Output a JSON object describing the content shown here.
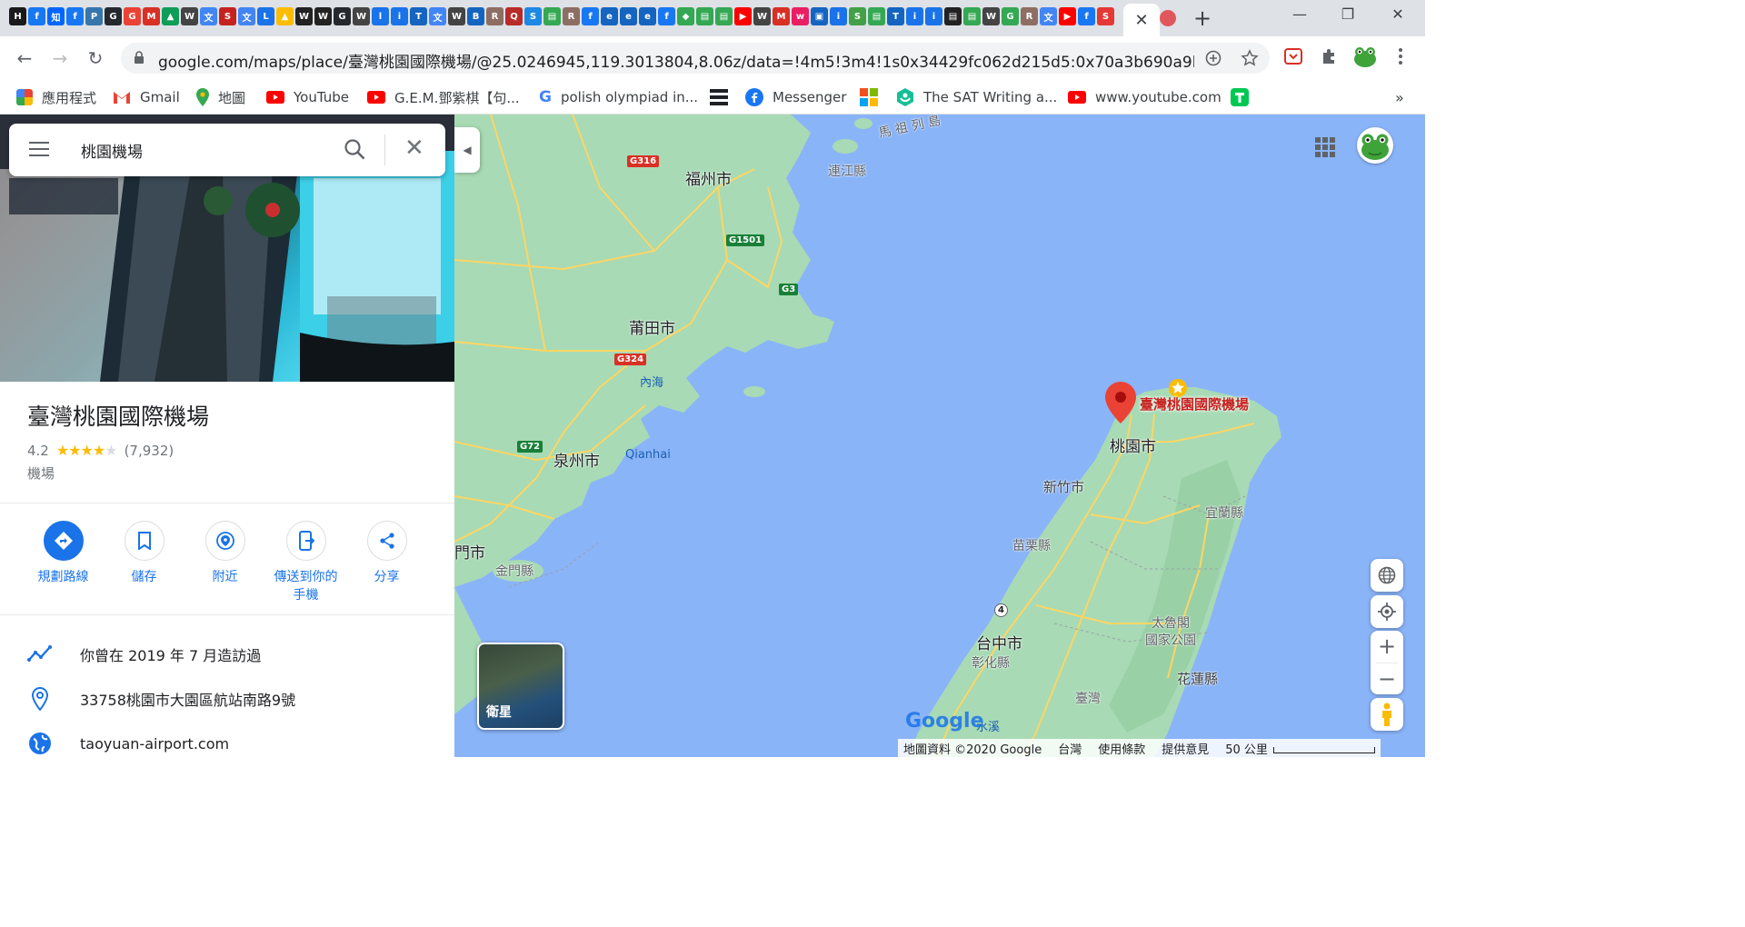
{
  "browser": {
    "favicons": [
      {
        "glyph": "H",
        "color": "#1a1a1a"
      },
      {
        "glyph": "f",
        "color": "#1877f2"
      },
      {
        "glyph": "知",
        "color": "#0066ff"
      },
      {
        "glyph": "f",
        "color": "#1877f2"
      },
      {
        "glyph": "P",
        "color": "#3776ab"
      },
      {
        "glyph": "G",
        "color": "#24292e"
      },
      {
        "glyph": "G",
        "color": "#ea4335"
      },
      {
        "glyph": "M",
        "color": "#d93025"
      },
      {
        "glyph": "▲",
        "color": "#0f9d58"
      },
      {
        "glyph": "W",
        "color": "#444444"
      },
      {
        "glyph": "文",
        "color": "#4285f4"
      },
      {
        "glyph": "S",
        "color": "#c5221f"
      },
      {
        "glyph": "文",
        "color": "#4285f4"
      },
      {
        "glyph": "L",
        "color": "#1a73e8"
      },
      {
        "glyph": "▲",
        "color": "#fbbc04"
      },
      {
        "glyph": "W",
        "color": "#222222"
      },
      {
        "glyph": "W",
        "color": "#222222"
      },
      {
        "glyph": "G",
        "color": "#24292e"
      },
      {
        "glyph": "W",
        "color": "#444444"
      },
      {
        "glyph": "l",
        "color": "#1a73e8"
      },
      {
        "glyph": "i",
        "color": "#1a73e8"
      },
      {
        "glyph": "T",
        "color": "#1565c0"
      },
      {
        "glyph": "文",
        "color": "#4285f4"
      },
      {
        "glyph": "W",
        "color": "#444444"
      },
      {
        "glyph": "B",
        "color": "#1565c0"
      },
      {
        "glyph": "R",
        "color": "#8d6e63"
      },
      {
        "glyph": "Q",
        "color": "#b92b27"
      },
      {
        "glyph": "S",
        "color": "#1e88e5"
      },
      {
        "glyph": "▤",
        "color": "#34a853"
      },
      {
        "glyph": "R",
        "color": "#8d6e63"
      },
      {
        "glyph": "f",
        "color": "#1877f2"
      },
      {
        "glyph": "e",
        "color": "#1565c0"
      },
      {
        "glyph": "e",
        "color": "#1565c0"
      },
      {
        "glyph": "e",
        "color": "#1565c0"
      },
      {
        "glyph": "f",
        "color": "#1877f2"
      },
      {
        "glyph": "◆",
        "color": "#34a853"
      },
      {
        "glyph": "▤",
        "color": "#34a853"
      },
      {
        "glyph": "▤",
        "color": "#34a853"
      },
      {
        "glyph": "▶",
        "color": "#ff0000"
      },
      {
        "glyph": "W",
        "color": "#444444"
      },
      {
        "glyph": "M",
        "color": "#d93025"
      },
      {
        "glyph": "w",
        "color": "#e91e63"
      },
      {
        "glyph": "▣",
        "color": "#1565c0"
      },
      {
        "glyph": "i",
        "color": "#1a73e8"
      },
      {
        "glyph": "S",
        "color": "#43a047"
      },
      {
        "glyph": "▤",
        "color": "#34a853"
      },
      {
        "glyph": "T",
        "color": "#1565c0"
      },
      {
        "glyph": "i",
        "color": "#1a73e8"
      },
      {
        "glyph": "i",
        "color": "#1a73e8"
      },
      {
        "glyph": "▤",
        "color": "#222222"
      },
      {
        "glyph": "▤",
        "color": "#34a853"
      },
      {
        "glyph": "W",
        "color": "#444444"
      },
      {
        "glyph": "G",
        "color": "#34a853"
      },
      {
        "glyph": "R",
        "color": "#8d6e63"
      },
      {
        "glyph": "文",
        "color": "#4285f4"
      },
      {
        "glyph": "▶",
        "color": "#ff0000"
      },
      {
        "glyph": "f",
        "color": "#1877f2"
      },
      {
        "glyph": "S",
        "color": "#e53935"
      }
    ],
    "window_controls": {
      "minimize": "—",
      "restore": "❐",
      "close": "✕"
    },
    "new_tab": "+",
    "tab_close": "✕",
    "url": "google.com/maps/place/臺灣桃園國際機場/@25.0246945,119.3013804,8.06z/data=!4m5!3m4!1s0x34429fc062d215d5:0x70a3b690a9b5b10...",
    "back": "←",
    "forward": "→",
    "reload": "↻"
  },
  "bookmarks": [
    {
      "label": "應用程式",
      "icon": "apps-grid-icon",
      "color": "#ea4335"
    },
    {
      "label": "Gmail",
      "icon": "gmail-icon",
      "color": "#ea4335"
    },
    {
      "label": "地圖",
      "icon": "maps-pin-icon",
      "color": "#34a853"
    },
    {
      "label": "YouTube",
      "icon": "youtube-icon",
      "color": "#ff0000"
    },
    {
      "label": "G.E.M.鄧紫棋【句...",
      "icon": "youtube-icon",
      "color": "#ff0000"
    },
    {
      "label": "polish olympiad in...",
      "icon": "google-icon",
      "color": "#4285f4"
    },
    {
      "label": "",
      "icon": "list-icon",
      "color": "#202124"
    },
    {
      "label": "Messenger",
      "icon": "facebook-icon",
      "color": "#1877f2"
    },
    {
      "label": "",
      "icon": "microsoft-icon",
      "color": "#f25022"
    },
    {
      "label": "The SAT Writing a...",
      "icon": "khan-icon",
      "color": "#14bf96"
    },
    {
      "label": "www.youtube.com",
      "icon": "youtube-icon",
      "color": "#ff0000"
    },
    {
      "label": "",
      "icon": "green-t-icon",
      "color": "#00c853"
    }
  ],
  "bookmarks_more": "»",
  "search": {
    "query": "桃園機場"
  },
  "place": {
    "title": "臺灣桃園國際機場",
    "rating": "4.2",
    "rating_value": 4.2,
    "stars": "★★★★",
    "stars_off": "★",
    "reviews": "(7,932)",
    "category": "機場"
  },
  "actions": [
    {
      "label": "規劃路線",
      "icon": "directions-icon",
      "primary": true
    },
    {
      "label": "儲存",
      "icon": "bookmark-icon",
      "primary": false
    },
    {
      "label": "附近",
      "icon": "nearby-icon",
      "primary": false
    },
    {
      "label": "傳送到你的\n手機",
      "icon": "send-to-phone-icon",
      "primary": false
    },
    {
      "label": "分享",
      "icon": "share-icon",
      "primary": false
    }
  ],
  "info": [
    {
      "text": "你曾在 2019 年 7 月造訪過",
      "icon": "timeline-icon"
    },
    {
      "text": "33758桃園市大園區航站南路9號",
      "icon": "location-pin-icon"
    },
    {
      "text": "taoyuan-airport.com",
      "icon": "globe-icon"
    }
  ],
  "map": {
    "labels": {
      "fuzhou": "福州市",
      "lianjiang": "連江縣",
      "matsu": "馬 祖 列 島",
      "putian": "莆田市",
      "neihai": "內海",
      "quanzhou": "泉州市",
      "qianhai": "Qianhai",
      "kinmen": "金門縣",
      "xiamen": "門市",
      "taoyuan": "桃園市",
      "hsinchu": "新竹市",
      "yilan": "宜蘭縣",
      "miaoli": "苗栗縣",
      "taichung": "台中市",
      "changhua": "彰化縣",
      "taroko": "太魯閣\n國家公園",
      "hualien": "花蓮縣",
      "taiwan": "臺灣",
      "shuixi": "水溪"
    },
    "highways": [
      "G316",
      "G1501",
      "G3",
      "G324",
      "G72",
      "4"
    ],
    "pin_label": "臺灣桃園國際機場",
    "satellite_label": "衛星",
    "attribution": [
      "地圖資料 ©2020 Google",
      "台灣",
      "使用條款",
      "提供意見",
      "50 公里"
    ],
    "google_logo": "Google",
    "zoom_in": "+",
    "zoom_out": "−",
    "colors": {
      "water": "#8ab4f8",
      "land": "#a8dab5",
      "road": "#fdd663",
      "pin": "#ea4335"
    }
  }
}
